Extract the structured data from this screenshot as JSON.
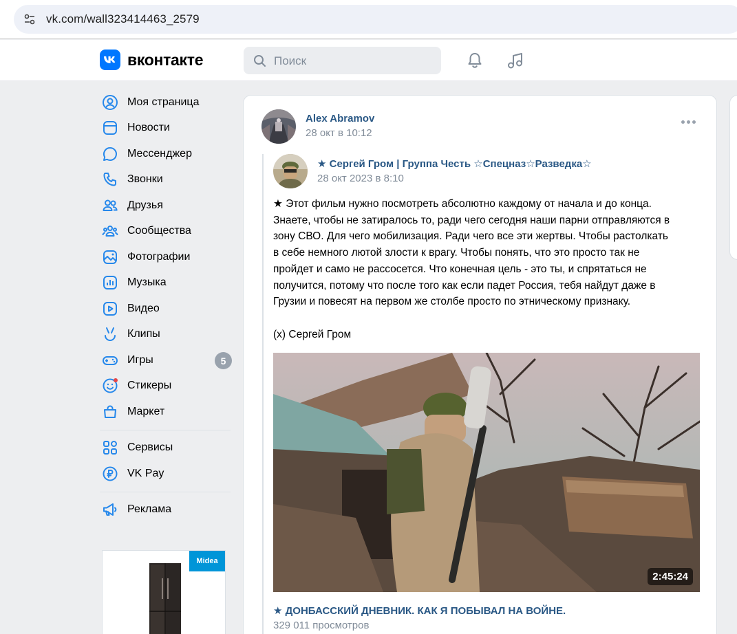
{
  "browser": {
    "url": "vk.com/wall323414463_2579"
  },
  "header": {
    "logo_text": "вконтакте",
    "search_placeholder": "Поиск",
    "accent": "#0077ff"
  },
  "sidebar": {
    "items": [
      {
        "label": "Моя страница",
        "icon": "user-circle-icon"
      },
      {
        "label": "Новости",
        "icon": "news-icon"
      },
      {
        "label": "Мессенджер",
        "icon": "message-icon"
      },
      {
        "label": "Звонки",
        "icon": "phone-icon"
      },
      {
        "label": "Друзья",
        "icon": "friends-icon"
      },
      {
        "label": "Сообщества",
        "icon": "communities-icon"
      },
      {
        "label": "Фотографии",
        "icon": "photo-icon"
      },
      {
        "label": "Музыка",
        "icon": "music-icon"
      },
      {
        "label": "Видео",
        "icon": "video-icon"
      },
      {
        "label": "Клипы",
        "icon": "clips-icon"
      },
      {
        "label": "Игры",
        "icon": "games-icon",
        "badge": "5"
      },
      {
        "label": "Стикеры",
        "icon": "stickers-icon"
      },
      {
        "label": "Маркет",
        "icon": "market-icon"
      }
    ],
    "secondary": [
      {
        "label": "Сервисы",
        "icon": "services-icon"
      },
      {
        "label": "VK Pay",
        "icon": "vkpay-icon"
      }
    ],
    "tertiary": [
      {
        "label": "Реклама",
        "icon": "megaphone-icon"
      }
    ],
    "ad_brand": "Midea"
  },
  "post": {
    "author": "Alex Abramov",
    "date": "28 окт в 10:12",
    "repost": {
      "author": "★ Сергей Гром | Группа Честь ☆Спецназ☆Разведка☆",
      "date": "28 окт 2023 в 8:10",
      "text": "★ Этот фильм нужно посмотреть абсолютно каждому от начала и до конца.\nЗнаете, чтобы не затиралось то, ради чего сегодня наши парни отправляются в\nзону СВО. Для чего мобилизация. Ради чего все эти жертвы. Чтобы растолкать\nв себе немного лютой злости к врагу. Чтобы понять, что это просто так не\nпройдет и само не рассосется. Что конечная цель - это ты, и спрятаться не\nполучится, потому что после того как если падет Россия, тебя найдут даже в\nГрузии и повесят на первом же столбе просто по этническому признаку.\n\n(х) Сергей Гром",
      "video": {
        "duration": "2:45:24",
        "title": "★ ДОНБАССКИЙ ДНЕВНИК. КАК Я ПОБЫВАЛ НА ВОЙНЕ.",
        "views": "329 011 просмотров"
      }
    }
  }
}
